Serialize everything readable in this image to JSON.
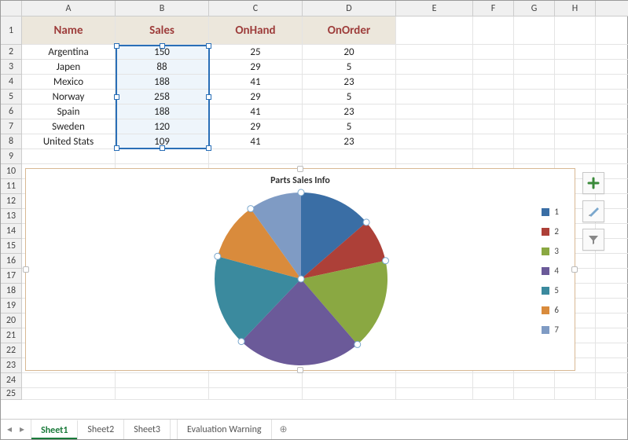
{
  "columns": [
    "A",
    "B",
    "C",
    "D",
    "E",
    "F",
    "G",
    "H"
  ],
  "row_count": 25,
  "table": {
    "headers": [
      "Name",
      "Sales",
      "OnHand",
      "OnOrder"
    ],
    "rows": [
      {
        "name": "Argentina",
        "sales": 150,
        "onhand": 25,
        "onorder": 20
      },
      {
        "name": "Japen",
        "sales": 88,
        "onhand": 29,
        "onorder": 5
      },
      {
        "name": "Mexico",
        "sales": 188,
        "onhand": 41,
        "onorder": 23
      },
      {
        "name": "Norway",
        "sales": 258,
        "onhand": 29,
        "onorder": 5
      },
      {
        "name": "Spain",
        "sales": 188,
        "onhand": 41,
        "onorder": 23
      },
      {
        "name": "Sweden",
        "sales": 120,
        "onhand": 29,
        "onorder": 5
      },
      {
        "name": "United Stats",
        "sales": 109,
        "onhand": 41,
        "onorder": 23
      }
    ]
  },
  "selection": {
    "range": "B2:B8"
  },
  "chart_data": {
    "type": "pie",
    "title": "Parts Sales Info",
    "series_name": "Sales",
    "categories": [
      "1",
      "2",
      "3",
      "4",
      "5",
      "6",
      "7"
    ],
    "values": [
      150,
      88,
      188,
      258,
      188,
      120,
      109
    ],
    "colors": [
      "#3a6ea5",
      "#ad4038",
      "#8aa842",
      "#6b5a99",
      "#3b8a9e",
      "#d98b3c",
      "#7f9bc4"
    ],
    "legend_position": "right"
  },
  "chart_tools": {
    "add": "+",
    "brush": "brush-icon",
    "filter": "filter-icon"
  },
  "tabs": {
    "nav_prev": "◂",
    "nav_next": "▸",
    "sheets": [
      "Sheet1",
      "Sheet2",
      "Sheet3"
    ],
    "extra": [
      "Evaluation Warning"
    ],
    "active": "Sheet1",
    "add": "⊕"
  }
}
